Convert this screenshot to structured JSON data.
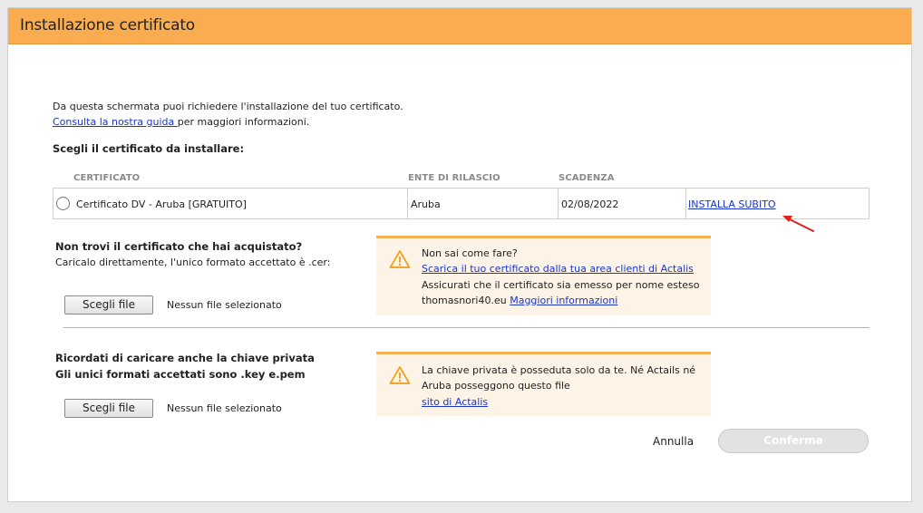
{
  "dialog": {
    "title": "Installazione certificato"
  },
  "intro": {
    "line1": "Da questa schermata puoi richiedere l'installazione del tuo certificato.",
    "guide_link": "Consulta la nostra guida ",
    "line2_suffix": "per maggiori informazioni."
  },
  "choose_title": "Scegli il certificato da installare:",
  "table": {
    "headers": {
      "certificate": "CERTIFICATO",
      "issuer": "ENTE DI RILASCIO",
      "expiry": "SCADENZA"
    },
    "row": {
      "certificate": "Certificato DV - Aruba [GRATUITO]",
      "issuer": "Aruba",
      "expiry": "02/08/2022",
      "action": "INSTALLA SUBITO"
    }
  },
  "cert_upload": {
    "title": "Non trovi il certificato che hai acquistato?",
    "subtitle": "Caricalo direttamente, l'unico formato accettato è .cer:",
    "button": "Scegli file",
    "status": "Nessun file selezionato",
    "alert": {
      "line1": "Non sai come fare?",
      "link1": "Scarica il tuo certificato dalla tua area clienti di Actalis",
      "line3": "Assicurati che il certificato sia emesso per nome esteso",
      "line4_prefix": "thomasnori40.eu ",
      "link2": "Maggiori informazioni"
    }
  },
  "key_upload": {
    "title1": "Ricordati di caricare anche la chiave privata",
    "title2": "Gli unici formati accettati sono .key e.pem",
    "button": "Scegli file",
    "status": "Nessun file selezionato",
    "alert": {
      "line1": "La chiave privata è posseduta solo da te. Né Actails né",
      "line2": "Aruba posseggono questo file",
      "link": "sito di Actalis"
    }
  },
  "footer": {
    "cancel": "Annulla",
    "confirm": "Conferma"
  },
  "colors": {
    "header": "#f9ad50",
    "alert_border": "#f6ae50",
    "alert_bg": "#fdf4e7",
    "link": "#1a35c9",
    "arrow": "#e0201b"
  }
}
